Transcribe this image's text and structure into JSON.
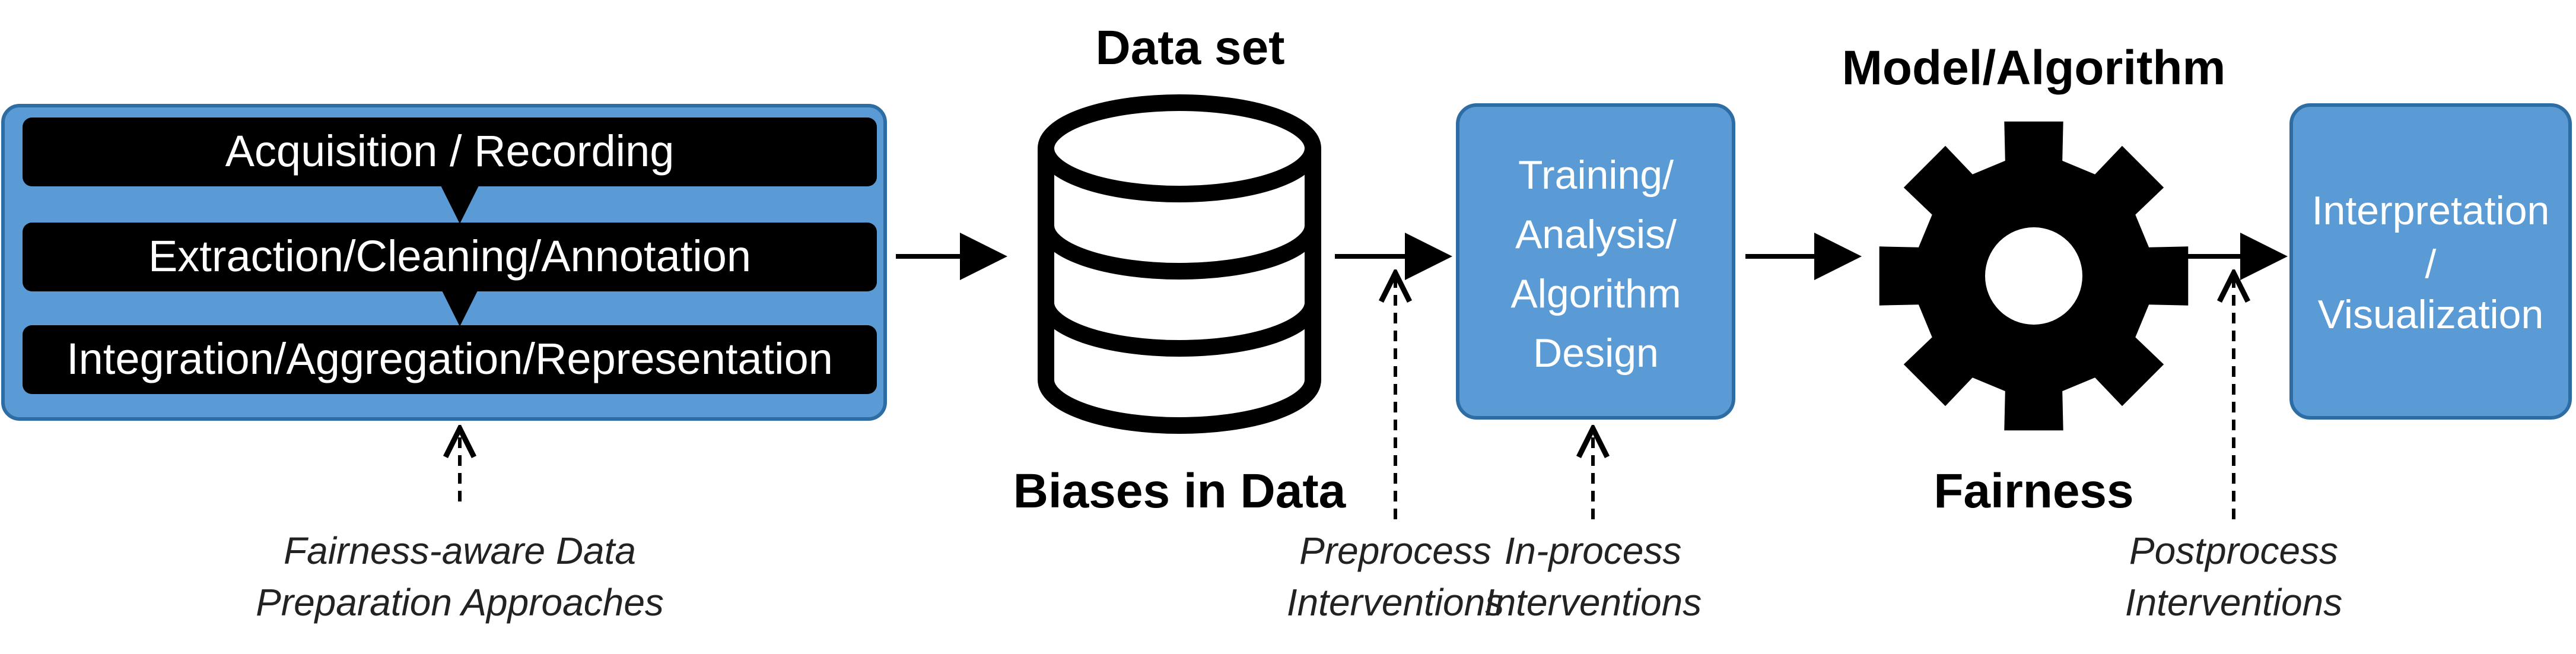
{
  "colors": {
    "box_fill": "#5B9BD5",
    "box_stroke": "#2E6DA4",
    "stage_fill": "#000000",
    "stage_text": "#FFFFFF",
    "arrow": "#000000",
    "note_text": "#222222"
  },
  "pipeline": {
    "stages": [
      {
        "label": "Acquisition / Recording"
      },
      {
        "label": "Extraction/Cleaning/Annotation"
      },
      {
        "label": "Integration/Aggregation/Representation"
      }
    ],
    "note_line1": "Fairness-aware Data",
    "note_line2": "Preparation Approaches"
  },
  "dataset": {
    "title": "Data set",
    "icon": "database-icon",
    "caption": "Biases in Data"
  },
  "training": {
    "line1": "Training/",
    "line2": "Analysis/",
    "line3": "Algorithm",
    "line4": "Design"
  },
  "model": {
    "title": "Model/Algorithm",
    "icon": "gear-icon",
    "caption": "Fairness"
  },
  "interpretation": {
    "line1": "Interpretation",
    "line2": "/",
    "line3": "Visualization"
  },
  "notes": {
    "preprocess_line1": "Preprocess",
    "preprocess_line2": "Interventions",
    "inprocess_line1": "In-process",
    "inprocess_line2": "Interventions",
    "postprocess_line1": "Postprocess",
    "postprocess_line2": "Interventions"
  }
}
